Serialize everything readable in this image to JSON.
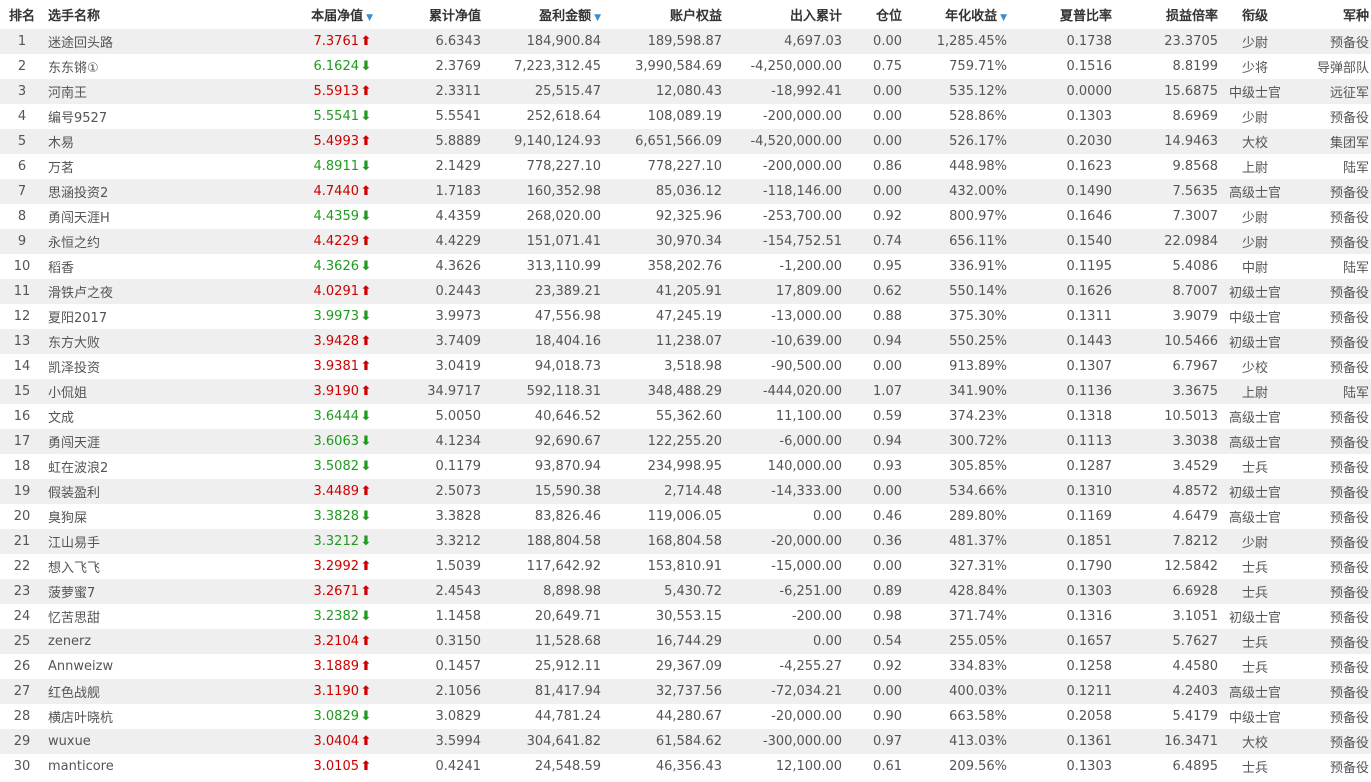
{
  "columns": [
    {
      "key": "rank",
      "label": "排名",
      "sort": false
    },
    {
      "key": "name",
      "label": "选手名称",
      "sort": false
    },
    {
      "key": "nav",
      "label": "本届净值",
      "sort": true
    },
    {
      "key": "cum",
      "label": "累计净值",
      "sort": false
    },
    {
      "key": "profit",
      "label": "盈利金额",
      "sort": true
    },
    {
      "key": "equity",
      "label": "账户权益",
      "sort": false
    },
    {
      "key": "flow",
      "label": "出入累计",
      "sort": false
    },
    {
      "key": "position",
      "label": "仓位",
      "sort": false
    },
    {
      "key": "annual",
      "label": "年化收益",
      "sort": true
    },
    {
      "key": "sharpe",
      "label": "夏普比率",
      "sort": false
    },
    {
      "key": "pl",
      "label": "损益倍率",
      "sort": false
    },
    {
      "key": "rankTitle",
      "label": "衔级",
      "sort": false
    },
    {
      "key": "army",
      "label": "军种",
      "sort": false
    }
  ],
  "icons": {
    "sort": "sort-down-triangle-icon",
    "up": "arrow-up-icon",
    "down": "arrow-down-icon"
  },
  "colors": {
    "up": "#cc0000",
    "down": "#1f9a1f",
    "sort": "#3a8fd0",
    "stripe": "#efefef"
  },
  "rows": [
    {
      "rank": "1",
      "name": "迷途回头路",
      "nav": "7.3761",
      "dir": "up",
      "cum": "6.6343",
      "profit": "184,900.84",
      "equity": "189,598.87",
      "flow": "4,697.03",
      "position": "0.00",
      "annual": "1,285.45%",
      "sharpe": "0.1738",
      "pl": "23.3705",
      "rankTitle": "少尉",
      "army": "预备役"
    },
    {
      "rank": "2",
      "name": "东东锵①",
      "nav": "6.1624",
      "dir": "down",
      "cum": "2.3769",
      "profit": "7,223,312.45",
      "equity": "3,990,584.69",
      "flow": "-4,250,000.00",
      "position": "0.75",
      "annual": "759.71%",
      "sharpe": "0.1516",
      "pl": "8.8199",
      "rankTitle": "少将",
      "army": "导弹部队"
    },
    {
      "rank": "3",
      "name": "河南王",
      "nav": "5.5913",
      "dir": "up",
      "cum": "2.3311",
      "profit": "25,515.47",
      "equity": "12,080.43",
      "flow": "-18,992.41",
      "position": "0.00",
      "annual": "535.12%",
      "sharpe": "0.0000",
      "pl": "15.6875",
      "rankTitle": "中级士官",
      "army": "远征军"
    },
    {
      "rank": "4",
      "name": "编号9527",
      "nav": "5.5541",
      "dir": "down",
      "cum": "5.5541",
      "profit": "252,618.64",
      "equity": "108,089.19",
      "flow": "-200,000.00",
      "position": "0.00",
      "annual": "528.86%",
      "sharpe": "0.1303",
      "pl": "8.6969",
      "rankTitle": "少尉",
      "army": "预备役"
    },
    {
      "rank": "5",
      "name": "木易",
      "nav": "5.4993",
      "dir": "up",
      "cum": "5.8889",
      "profit": "9,140,124.93",
      "equity": "6,651,566.09",
      "flow": "-4,520,000.00",
      "position": "0.00",
      "annual": "526.17%",
      "sharpe": "0.2030",
      "pl": "14.9463",
      "rankTitle": "大校",
      "army": "集团军"
    },
    {
      "rank": "6",
      "name": "万茗",
      "nav": "4.8911",
      "dir": "down",
      "cum": "2.1429",
      "profit": "778,227.10",
      "equity": "778,227.10",
      "flow": "-200,000.00",
      "position": "0.86",
      "annual": "448.98%",
      "sharpe": "0.1623",
      "pl": "9.8568",
      "rankTitle": "上尉",
      "army": "陆军"
    },
    {
      "rank": "7",
      "name": "思涵投资2",
      "nav": "4.7440",
      "dir": "up",
      "cum": "1.7183",
      "profit": "160,352.98",
      "equity": "85,036.12",
      "flow": "-118,146.00",
      "position": "0.00",
      "annual": "432.00%",
      "sharpe": "0.1490",
      "pl": "7.5635",
      "rankTitle": "高级士官",
      "army": "预备役"
    },
    {
      "rank": "8",
      "name": "勇闯天涯H",
      "nav": "4.4359",
      "dir": "down",
      "cum": "4.4359",
      "profit": "268,020.00",
      "equity": "92,325.96",
      "flow": "-253,700.00",
      "position": "0.92",
      "annual": "800.97%",
      "sharpe": "0.1646",
      "pl": "7.3007",
      "rankTitle": "少尉",
      "army": "预备役"
    },
    {
      "rank": "9",
      "name": "永恒之约",
      "nav": "4.4229",
      "dir": "up",
      "cum": "4.4229",
      "profit": "151,071.41",
      "equity": "30,970.34",
      "flow": "-154,752.51",
      "position": "0.74",
      "annual": "656.11%",
      "sharpe": "0.1540",
      "pl": "22.0984",
      "rankTitle": "少尉",
      "army": "预备役"
    },
    {
      "rank": "10",
      "name": "稻香",
      "nav": "4.3626",
      "dir": "down",
      "cum": "4.3626",
      "profit": "313,110.99",
      "equity": "358,202.76",
      "flow": "-1,200.00",
      "position": "0.95",
      "annual": "336.91%",
      "sharpe": "0.1195",
      "pl": "5.4086",
      "rankTitle": "中尉",
      "army": "陆军"
    },
    {
      "rank": "11",
      "name": "滑铁卢之夜",
      "nav": "4.0291",
      "dir": "up",
      "cum": "0.2443",
      "profit": "23,389.21",
      "equity": "41,205.91",
      "flow": "17,809.00",
      "position": "0.62",
      "annual": "550.14%",
      "sharpe": "0.1626",
      "pl": "8.7007",
      "rankTitle": "初级士官",
      "army": "预备役"
    },
    {
      "rank": "12",
      "name": "夏阳2017",
      "nav": "3.9973",
      "dir": "down",
      "cum": "3.9973",
      "profit": "47,556.98",
      "equity": "47,245.19",
      "flow": "-13,000.00",
      "position": "0.88",
      "annual": "375.30%",
      "sharpe": "0.1311",
      "pl": "3.9079",
      "rankTitle": "中级士官",
      "army": "预备役"
    },
    {
      "rank": "13",
      "name": "东方大败",
      "nav": "3.9428",
      "dir": "up",
      "cum": "3.7409",
      "profit": "18,404.16",
      "equity": "11,238.07",
      "flow": "-10,639.00",
      "position": "0.94",
      "annual": "550.25%",
      "sharpe": "0.1443",
      "pl": "10.5466",
      "rankTitle": "初级士官",
      "army": "预备役"
    },
    {
      "rank": "14",
      "name": "凯泽投资",
      "nav": "3.9381",
      "dir": "up",
      "cum": "3.0419",
      "profit": "94,018.73",
      "equity": "3,518.98",
      "flow": "-90,500.00",
      "position": "0.00",
      "annual": "913.89%",
      "sharpe": "0.1307",
      "pl": "6.7967",
      "rankTitle": "少校",
      "army": "预备役"
    },
    {
      "rank": "15",
      "name": "小侃姐",
      "nav": "3.9190",
      "dir": "up",
      "cum": "34.9717",
      "profit": "592,118.31",
      "equity": "348,488.29",
      "flow": "-444,020.00",
      "position": "1.07",
      "annual": "341.90%",
      "sharpe": "0.1136",
      "pl": "3.3675",
      "rankTitle": "上尉",
      "army": "陆军"
    },
    {
      "rank": "16",
      "name": "文成",
      "nav": "3.6444",
      "dir": "down",
      "cum": "5.0050",
      "profit": "40,646.52",
      "equity": "55,362.60",
      "flow": "11,100.00",
      "position": "0.59",
      "annual": "374.23%",
      "sharpe": "0.1318",
      "pl": "10.5013",
      "rankTitle": "高级士官",
      "army": "预备役"
    },
    {
      "rank": "17",
      "name": "勇闯天涯",
      "nav": "3.6063",
      "dir": "down",
      "cum": "4.1234",
      "profit": "92,690.67",
      "equity": "122,255.20",
      "flow": "-6,000.00",
      "position": "0.94",
      "annual": "300.72%",
      "sharpe": "0.1113",
      "pl": "3.3038",
      "rankTitle": "高级士官",
      "army": "预备役"
    },
    {
      "rank": "18",
      "name": "虹在波浪2",
      "nav": "3.5082",
      "dir": "down",
      "cum": "0.1179",
      "profit": "93,870.94",
      "equity": "234,998.95",
      "flow": "140,000.00",
      "position": "0.93",
      "annual": "305.85%",
      "sharpe": "0.1287",
      "pl": "3.4529",
      "rankTitle": "士兵",
      "army": "预备役"
    },
    {
      "rank": "19",
      "name": "假装盈利",
      "nav": "3.4489",
      "dir": "up",
      "cum": "2.5073",
      "profit": "15,590.38",
      "equity": "2,714.48",
      "flow": "-14,333.00",
      "position": "0.00",
      "annual": "534.66%",
      "sharpe": "0.1310",
      "pl": "4.8572",
      "rankTitle": "初级士官",
      "army": "预备役"
    },
    {
      "rank": "20",
      "name": "臭狗屎",
      "nav": "3.3828",
      "dir": "down",
      "cum": "3.3828",
      "profit": "83,826.46",
      "equity": "119,006.05",
      "flow": "0.00",
      "position": "0.46",
      "annual": "289.80%",
      "sharpe": "0.1169",
      "pl": "4.6479",
      "rankTitle": "高级士官",
      "army": "预备役"
    },
    {
      "rank": "21",
      "name": "江山易手",
      "nav": "3.3212",
      "dir": "down",
      "cum": "3.3212",
      "profit": "188,804.58",
      "equity": "168,804.58",
      "flow": "-20,000.00",
      "position": "0.36",
      "annual": "481.37%",
      "sharpe": "0.1851",
      "pl": "7.8212",
      "rankTitle": "少尉",
      "army": "预备役"
    },
    {
      "rank": "22",
      "name": "想入飞飞",
      "nav": "3.2992",
      "dir": "up",
      "cum": "1.5039",
      "profit": "117,642.92",
      "equity": "153,810.91",
      "flow": "-15,000.00",
      "position": "0.00",
      "annual": "327.31%",
      "sharpe": "0.1790",
      "pl": "12.5842",
      "rankTitle": "士兵",
      "army": "预备役"
    },
    {
      "rank": "23",
      "name": "菠萝蜜7",
      "nav": "3.2671",
      "dir": "up",
      "cum": "2.4543",
      "profit": "8,898.98",
      "equity": "5,430.72",
      "flow": "-6,251.00",
      "position": "0.89",
      "annual": "428.84%",
      "sharpe": "0.1303",
      "pl": "6.6928",
      "rankTitle": "士兵",
      "army": "预备役"
    },
    {
      "rank": "24",
      "name": "忆苦思甜",
      "nav": "3.2382",
      "dir": "down",
      "cum": "1.1458",
      "profit": "20,649.71",
      "equity": "30,553.15",
      "flow": "-200.00",
      "position": "0.98",
      "annual": "371.74%",
      "sharpe": "0.1316",
      "pl": "3.1051",
      "rankTitle": "初级士官",
      "army": "预备役"
    },
    {
      "rank": "25",
      "name": "zenerz",
      "nav": "3.2104",
      "dir": "up",
      "cum": "0.3150",
      "profit": "11,528.68",
      "equity": "16,744.29",
      "flow": "0.00",
      "position": "0.54",
      "annual": "255.05%",
      "sharpe": "0.1657",
      "pl": "5.7627",
      "rankTitle": "士兵",
      "army": "预备役"
    },
    {
      "rank": "26",
      "name": "Annweizw",
      "nav": "3.1889",
      "dir": "up",
      "cum": "0.1457",
      "profit": "25,912.11",
      "equity": "29,367.09",
      "flow": "-4,255.27",
      "position": "0.92",
      "annual": "334.83%",
      "sharpe": "0.1258",
      "pl": "4.4580",
      "rankTitle": "士兵",
      "army": "预备役"
    },
    {
      "rank": "27",
      "name": "红色战舰",
      "nav": "3.1190",
      "dir": "up",
      "cum": "2.1056",
      "profit": "81,417.94",
      "equity": "32,737.56",
      "flow": "-72,034.21",
      "position": "0.00",
      "annual": "400.03%",
      "sharpe": "0.1211",
      "pl": "4.2403",
      "rankTitle": "高级士官",
      "army": "预备役"
    },
    {
      "rank": "28",
      "name": "横店叶晓杭",
      "nav": "3.0829",
      "dir": "down",
      "cum": "3.0829",
      "profit": "44,781.24",
      "equity": "44,280.67",
      "flow": "-20,000.00",
      "position": "0.90",
      "annual": "663.58%",
      "sharpe": "0.2058",
      "pl": "5.4179",
      "rankTitle": "中级士官",
      "army": "预备役"
    },
    {
      "rank": "29",
      "name": "wuxue",
      "nav": "3.0404",
      "dir": "up",
      "cum": "3.5994",
      "profit": "304,641.82",
      "equity": "61,584.62",
      "flow": "-300,000.00",
      "position": "0.97",
      "annual": "413.03%",
      "sharpe": "0.1361",
      "pl": "16.3471",
      "rankTitle": "大校",
      "army": "预备役"
    },
    {
      "rank": "30",
      "name": "manticore",
      "nav": "3.0105",
      "dir": "up",
      "cum": "0.4241",
      "profit": "24,548.59",
      "equity": "46,356.43",
      "flow": "12,100.00",
      "position": "0.61",
      "annual": "209.56%",
      "sharpe": "0.1303",
      "pl": "6.4895",
      "rankTitle": "士兵",
      "army": "预备役"
    }
  ]
}
